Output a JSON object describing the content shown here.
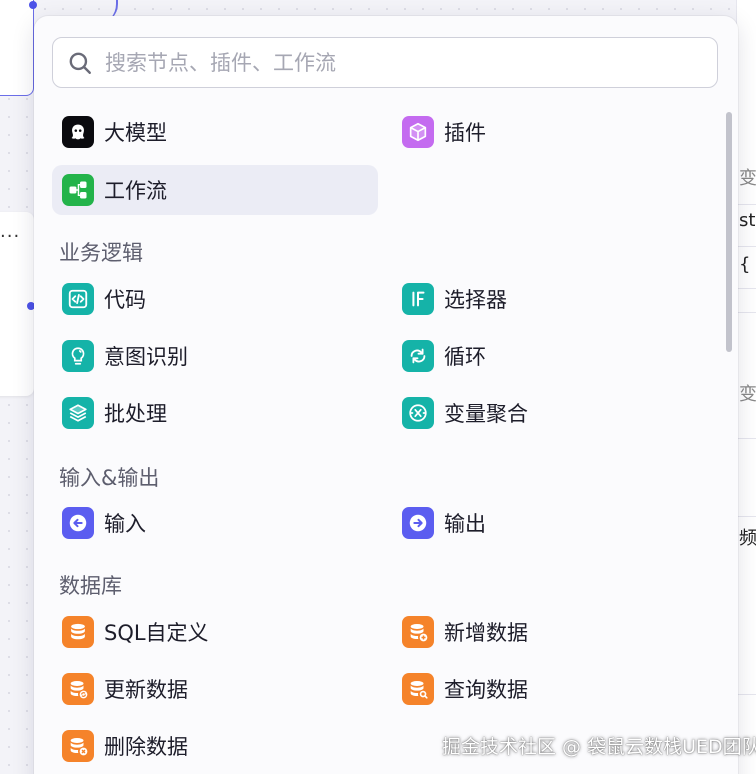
{
  "search": {
    "placeholder": "搜索节点、插件、工作流",
    "value": ""
  },
  "colors": {
    "llm": "#0b0b0f",
    "plugin": "#c46bf0",
    "workflow": "#23b34a",
    "logic": "#15b3a8",
    "io": "#5b5df0",
    "database": "#f5832a",
    "active_item_bg": "#ebecf5"
  },
  "top_items": [
    {
      "label": "大模型",
      "icon": "llm-icon"
    },
    {
      "label": "插件",
      "icon": "cube-icon"
    },
    {
      "label": "工作流",
      "icon": "workflow-icon",
      "active": true
    }
  ],
  "sections": [
    {
      "title": "业务逻辑",
      "items": [
        {
          "label": "代码",
          "icon": "code-icon"
        },
        {
          "label": "选择器",
          "icon": "if-icon"
        },
        {
          "label": "意图识别",
          "icon": "bulb-icon"
        },
        {
          "label": "循环",
          "icon": "loop-icon"
        },
        {
          "label": "批处理",
          "icon": "layers-icon"
        },
        {
          "label": "变量聚合",
          "icon": "aggregate-icon"
        }
      ]
    },
    {
      "title": "输入&输出",
      "items": [
        {
          "label": "输入",
          "icon": "input-arrow-icon"
        },
        {
          "label": "输出",
          "icon": "output-arrow-icon"
        }
      ]
    },
    {
      "title": "数据库",
      "items": [
        {
          "label": "SQL自定义",
          "icon": "database-icon"
        },
        {
          "label": "新增数据",
          "icon": "database-add-icon"
        },
        {
          "label": "更新数据",
          "icon": "database-refresh-icon"
        },
        {
          "label": "查询数据",
          "icon": "database-search-icon"
        },
        {
          "label": "删除数据",
          "icon": "database-delete-icon"
        }
      ]
    }
  ],
  "right_panel": {
    "texts": [
      "变量",
      "str",
      "{ }",
      "变量",
      "频"
    ]
  },
  "watermark": "掘金技术社区 @ 袋鼠云数栈UED团队"
}
